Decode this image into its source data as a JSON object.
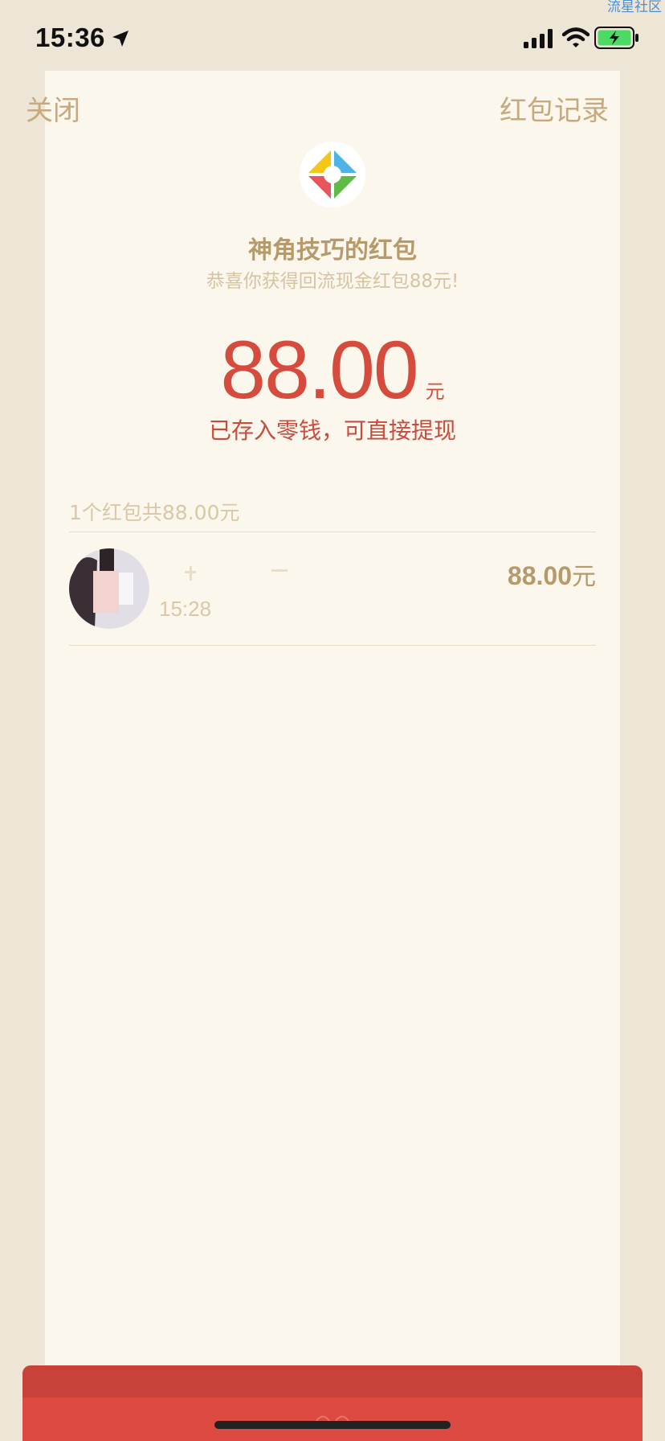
{
  "watermark": "流星社区",
  "status_bar": {
    "time": "15:36",
    "icons": [
      "location-arrow-icon",
      "cellular-signal-icon",
      "wifi-icon",
      "battery-charging-icon"
    ]
  },
  "nav": {
    "close_label": "关闭",
    "records_label": "红包记录"
  },
  "header": {
    "logo_icon": "app-logo-icon",
    "sender_title": "神角技巧的红包",
    "subtitle": "恭喜你获得回流现金红包88元!"
  },
  "amount": {
    "value": "88.00",
    "unit": "元",
    "note": "已存入零钱，可直接提现"
  },
  "records": {
    "summary": "1个红包共88.00元",
    "items": [
      {
        "time": "15:28",
        "amount": "88.00",
        "unit": "元"
      }
    ]
  },
  "colors": {
    "background": "#EDE6D6",
    "sheet": "#FCF7EC",
    "gold": "#B79A6B",
    "light_gold": "#D9C8A8",
    "red": "#D54B3E",
    "footer_red": "#DC4A41"
  }
}
